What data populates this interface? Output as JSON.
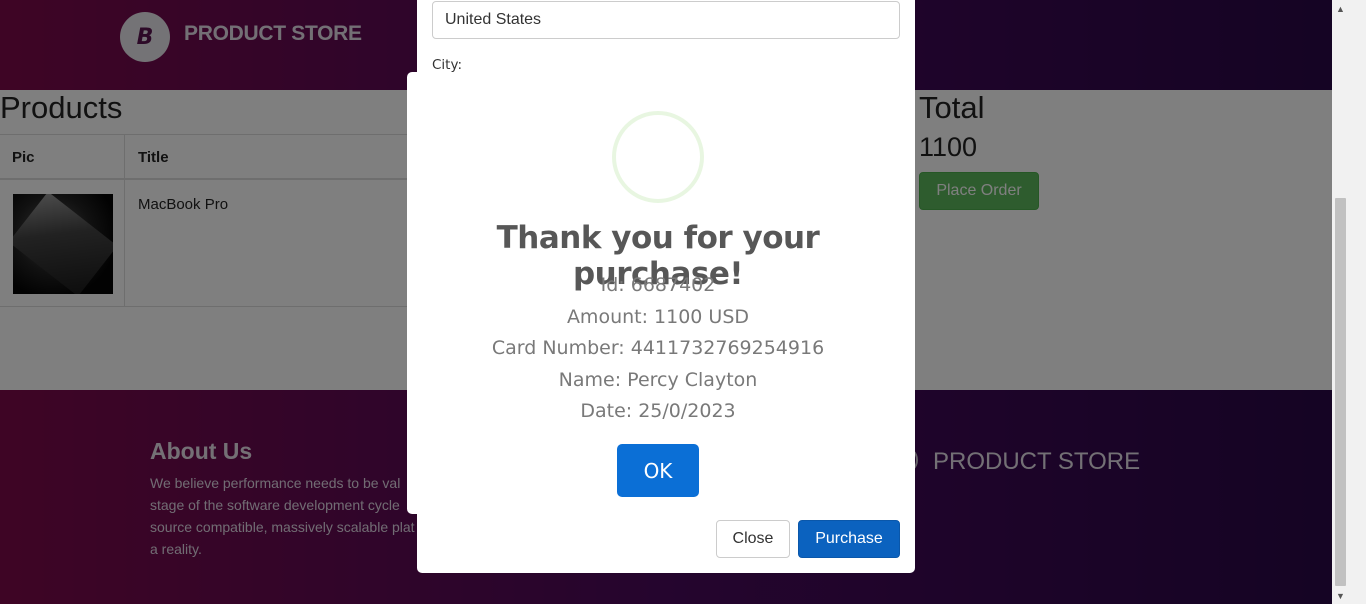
{
  "navbar": {
    "brand_logo_glyph": "B",
    "brand_name": "PRODUCT STORE"
  },
  "cart": {
    "products_heading": "Products",
    "columns": [
      "Pic",
      "Title"
    ],
    "items": [
      {
        "title": "MacBook Pro"
      }
    ],
    "total_heading": "Total",
    "total_value": "1100",
    "place_order_label": "Place Order"
  },
  "order_modal": {
    "country_value": "United States",
    "city_label": "City:",
    "close_label": "Close",
    "purchase_label": "Purchase"
  },
  "alert": {
    "title": "Thank you for your purchase!",
    "lines": [
      "Id: 6687402",
      "Amount: 1100 USD",
      "Card Number: 4411732769254916",
      "Name: Percy Clayton",
      "Date: 25/0/2023"
    ],
    "ok_label": "OK"
  },
  "footer": {
    "about_title": "About Us",
    "about_lines": [
      "We believe performance needs to be val",
      "stage of the software development cycle",
      "source compatible, massively scalable plat",
      "a reality."
    ],
    "brand_name": "PRODUCT STORE"
  },
  "icons": {
    "scroll_up": "chevron-up-icon",
    "scroll_down": "chevron-down-icon",
    "loading": "spinner-icon"
  },
  "colors": {
    "primary": "#0b62bf",
    "ok_button": "#0b6fd6",
    "place_order": "#5cb85c",
    "brand_gradient_start": "#7d0b4a",
    "brand_gradient_end": "#2a0848"
  }
}
